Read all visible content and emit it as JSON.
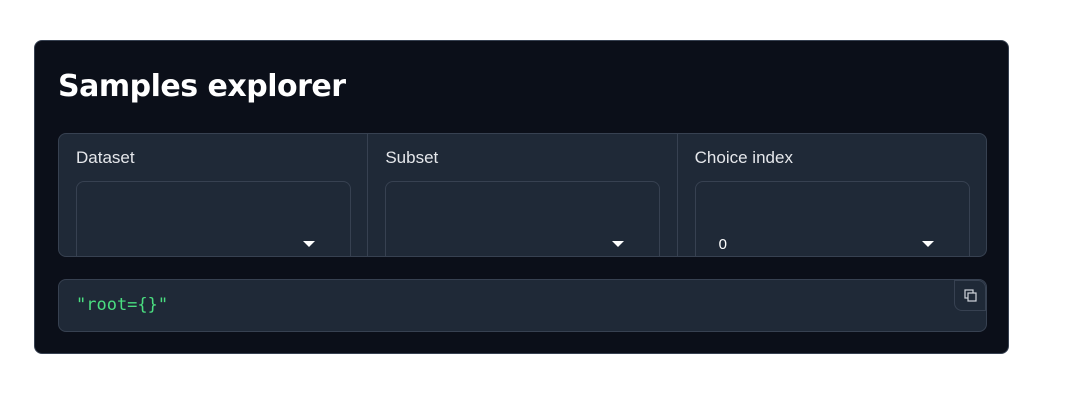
{
  "header": {
    "title": "Samples explorer"
  },
  "controls": [
    {
      "label": "Dataset",
      "value": ""
    },
    {
      "label": "Subset",
      "value": ""
    },
    {
      "label": "Choice index",
      "value": "0"
    }
  ],
  "json_output": {
    "text": "\"root={}\""
  },
  "icons": {
    "dropdown": "caret-down-icon",
    "copy": "copy-icon"
  },
  "colors": {
    "panel_bg": "#0b0f19",
    "block_bg": "#1f2937",
    "border": "#374151",
    "json_text": "#4ade80"
  }
}
